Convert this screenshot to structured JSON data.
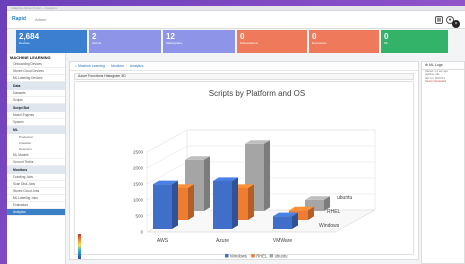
{
  "window": {
    "title": "Adaptive Admin Portal — Analytics"
  },
  "header": {
    "logo": "Rapid",
    "user": "Admin"
  },
  "tiles": [
    {
      "value": "2,684",
      "label": "Devices",
      "color": "#3b7fd0"
    },
    {
      "value": "2",
      "label": "Scripts",
      "color": "#8e95e8"
    },
    {
      "value": "12",
      "label": "Marketplace",
      "color": "#8e95e8"
    },
    {
      "value": "0",
      "label": "Subscriptions",
      "color": "#ef7a5b"
    },
    {
      "value": "0",
      "label": "Executions",
      "color": "#ef7a5b"
    },
    {
      "value": "0",
      "label": "ML",
      "color": "#33b36a"
    }
  ],
  "sidebar": {
    "title": "MACHINE LEARNING",
    "items_top": [
      "Onboarding Devices",
      "Stored Cloud Devices",
      "ML Labeling Devices"
    ],
    "sections": [
      {
        "label": "Data",
        "items": [
          "Datasets",
          "Scripts"
        ]
      },
      {
        "label": "Script Bot",
        "items": [
          "Model Engines",
          "Spaces"
        ]
      },
      {
        "label": "ML",
        "sub": [
          "Production",
          "Classifier",
          "Detectors"
        ],
        "items": [
          "ML Models",
          "Ground Truths"
        ]
      },
      {
        "label": "Monitors",
        "items": [
          "Crawling Jobs",
          "Scan Disk Jobs",
          "Stored Cloud Jobs",
          "ML Labeling Jobs",
          "Evaluators",
          "Analytics"
        ]
      }
    ]
  },
  "breadcrumb": [
    "Machine Learning",
    "Monitors",
    "Analytics"
  ],
  "panel": {
    "title": "Azure Functions Histogram 3D"
  },
  "log": {
    "title": "ML Logs",
    "lines": [
      "trained: 1.4 sec ago",
      "pipeline: idle",
      "last run: 00:00:12",
      "Server Connected"
    ]
  },
  "chart_data": {
    "type": "bar",
    "title": "Scripts by Platform and OS",
    "categories": [
      "AWS",
      "Azure",
      "VMWare"
    ],
    "series": [
      {
        "name": "Windows",
        "values": [
          1400,
          1500,
          400
        ]
      },
      {
        "name": "RHEL",
        "values": [
          1000,
          1000,
          300
        ]
      },
      {
        "name": "ubuntu",
        "values": [
          1600,
          2100,
          350
        ]
      }
    ],
    "ylim": [
      0,
      2500
    ],
    "yticks": [
      0,
      500,
      1000,
      1500,
      2000,
      2500
    ],
    "depth_labels": [
      "ubuntu",
      "RHEL",
      "Windows"
    ],
    "colors": {
      "Windows": "#3f6fc8",
      "RHEL": "#ee7d31",
      "ubuntu": "#a5a5a5"
    },
    "legend_position": "bottom"
  }
}
